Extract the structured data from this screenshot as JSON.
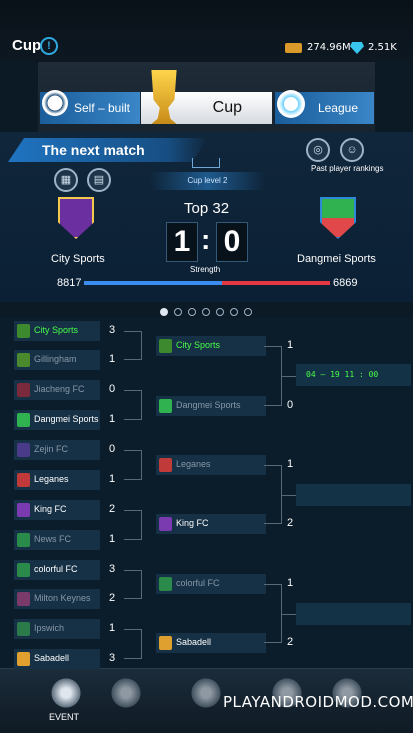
{
  "header": {
    "title": "Cup",
    "coins": "274.96M",
    "gems": "2.51K"
  },
  "tabs": [
    {
      "label": "Self – built"
    },
    {
      "label": "Cup"
    },
    {
      "label": "League"
    }
  ],
  "next_match": {
    "banner": "The next match",
    "past_label": "Past player rankings",
    "cup_level": "Cup level 2",
    "stage": "Top 32",
    "score_left": "1",
    "score_right": "0",
    "strength_label": "Strength",
    "home_team": "City Sports",
    "away_team": "Dangmei Sports",
    "home_strength": "8817",
    "away_strength": "6869",
    "home_strength_fraction": 0.5621
  },
  "bracket": {
    "round1": [
      {
        "name": "City Sports",
        "score": "3",
        "state": "winner",
        "color": "#3d8a2e"
      },
      {
        "name": "Gillingham",
        "score": "1",
        "state": "loser",
        "color": "#4a8a2c"
      },
      {
        "name": "Jiacheng FC",
        "score": "0",
        "state": "loser",
        "color": "#7a2a3a"
      },
      {
        "name": "Dangmei Sports",
        "score": "1",
        "state": "normal",
        "color": "#2fb24f"
      },
      {
        "name": "Zejin FC",
        "score": "0",
        "state": "loser",
        "color": "#4a3a8a"
      },
      {
        "name": "Leganes",
        "score": "1",
        "state": "normal",
        "color": "#c03a3a"
      },
      {
        "name": "King FC",
        "score": "2",
        "state": "normal",
        "color": "#7a3ab0"
      },
      {
        "name": "News FC",
        "score": "1",
        "state": "loser",
        "color": "#2a8a4a"
      },
      {
        "name": "colorful FC",
        "score": "3",
        "state": "normal",
        "color": "#2a8a4a"
      },
      {
        "name": "Milton Keynes",
        "score": "2",
        "state": "loser",
        "color": "#7a3a6a"
      },
      {
        "name": "Ipswich",
        "score": "1",
        "state": "loser",
        "color": "#2a7a4a"
      },
      {
        "name": "Sabadell",
        "score": "3",
        "state": "normal",
        "color": "#e0a030"
      }
    ],
    "round2": [
      {
        "name": "City Sports",
        "score": "1",
        "state": "winner",
        "color": "#3d8a2e"
      },
      {
        "name": "Dangmei Sports",
        "score": "0",
        "state": "loser",
        "color": "#2fb24f"
      },
      {
        "name": "Leganes",
        "score": "1",
        "state": "loser",
        "color": "#c03a3a"
      },
      {
        "name": "King FC",
        "score": "2",
        "state": "normal",
        "color": "#7a3ab0"
      },
      {
        "name": "colorful FC",
        "score": "1",
        "state": "loser",
        "color": "#2a8a4a"
      },
      {
        "name": "Sabadell",
        "score": "2",
        "state": "normal",
        "color": "#e0a030"
      }
    ],
    "round3_date": "04 – 19  11 : 00"
  },
  "bottom_nav": {
    "event_label": "EVENT"
  },
  "watermark": "PLAYANDROIDMOD.COM"
}
